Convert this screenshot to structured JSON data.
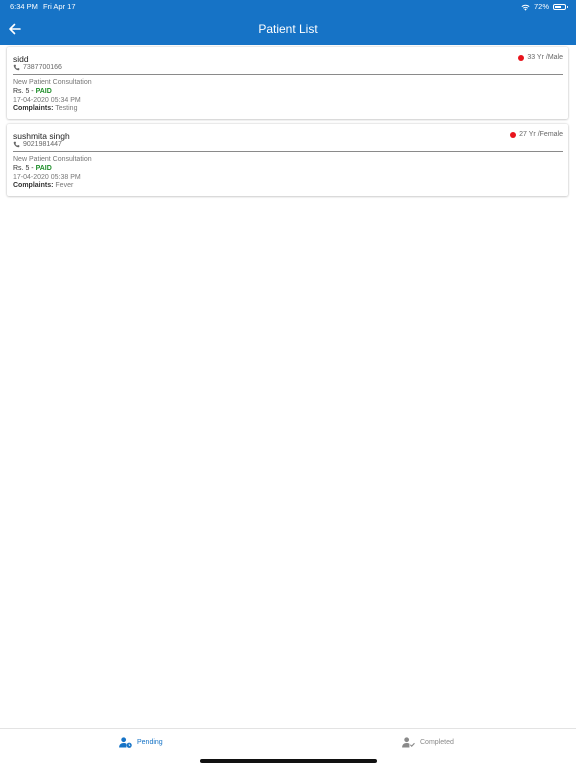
{
  "status_bar": {
    "time": "6:34 PM",
    "date": "Fri Apr 17",
    "battery": "72%",
    "battery_level": 0.72
  },
  "header": {
    "title": "Patient List",
    "background_color": "#1673c6"
  },
  "patients": [
    {
      "name": "sidd",
      "phone": "7387700166",
      "age_gender": "33 Yr /Male",
      "status_color": "#e8141c",
      "consultation": "New Patient Consultation",
      "amount": "Rs. 5",
      "separator": " - ",
      "payment_status": "PAID",
      "datetime": "17-04-2020 05:34 PM",
      "complaints_label": "Complaints:",
      "complaints": "Testing"
    },
    {
      "name": "sushmita singh",
      "phone": "9021981447",
      "age_gender": "27 Yr /Female",
      "status_color": "#e8141c",
      "consultation": "New Patient Consultation",
      "amount": "Rs. 5",
      "separator": " - ",
      "payment_status": "PAID",
      "datetime": "17-04-2020 05:38 PM",
      "complaints_label": "Complaints:",
      "complaints": "Fever"
    }
  ],
  "tabs": [
    {
      "label": "Pending",
      "icon": "person-clock-icon",
      "active": true,
      "color": "#1673c6"
    },
    {
      "label": "Completed",
      "icon": "person-check-icon",
      "active": false,
      "color": "#8a8a8a"
    }
  ]
}
